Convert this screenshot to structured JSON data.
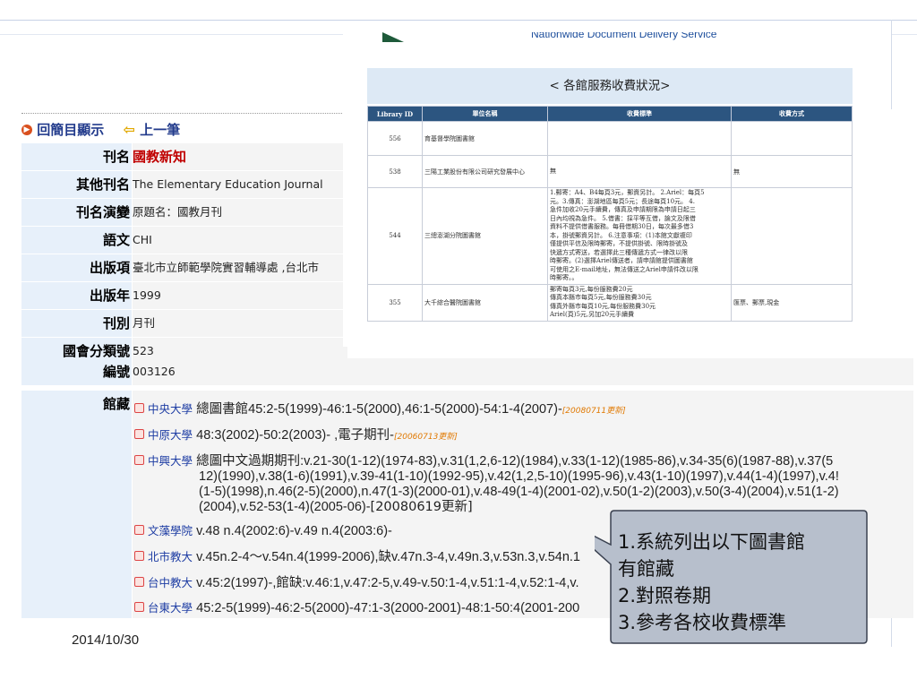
{
  "banner": {
    "text": "Nationwide Document Delivery Service"
  },
  "fee_table": {
    "heading": "< 各館服務收費狀況>",
    "columns": [
      "Library ID",
      "單位名稱",
      "收費標準",
      "收費方式"
    ],
    "rows": [
      {
        "id": "556",
        "name": "育基督學院圖書館",
        "fee": [],
        "method": ""
      },
      {
        "id": "538",
        "name": "三陽工業股份有限公司研究發展中心",
        "fee": [
          "無"
        ],
        "method": "無"
      },
      {
        "id": "544",
        "name": "三總澎湖分院圖書館",
        "fee": [
          "1.郵寄：A4、B4每頁3元，郵資另計。 2.Ariel：每頁5",
          "元。3.傳真：澎湖地區每頁5元；長途每頁10元。 4.",
          "急件加收20元手續費，傳真及申請期限為申請日起三",
          "日內均視為急件。 5.借書：採平等互借，論文及限借",
          "資料不提供借書服務。每冊借期30日，每次最多借3",
          "本，掛號郵資另計。 6.注意事項：(1)本館文獻複印",
          "僅提供平信及限時郵寄，不提供掛號、限時掛號及",
          "快遞方式寄送，若選擇此三種傳遞方式一律改以限",
          "時郵寄。(2)選擇Ariel傳送者，請申請館提供圖書館",
          "可使用之E-mail地址，無法傳送之Ariel申請件改以限",
          "時郵寄。。"
        ],
        "method": ""
      },
      {
        "id": "355",
        "name": "大千綜合醫院圖書館",
        "fee": [
          "郵寄每頁3元,每份服務費20元",
          "傳真本縣市每頁5元,每份服務費30元",
          "傳真外縣市每頁10元,每份服務費30元",
          "Ariel(頁)5元,另加20元手續費"
        ],
        "method": "匯票、郵票,現金"
      }
    ]
  },
  "nav": {
    "back_label": "回簡目顯示",
    "prev_label": "上一筆"
  },
  "record": {
    "title_label": "刊名",
    "title": "國教新知",
    "other_title_label": "其他刊名",
    "other_title": "The Elementary Education Journal",
    "history_label": "刊名演變",
    "history": "原題名：國教月刊",
    "language_label": "語文",
    "language": "CHI",
    "publisher_label": "出版項",
    "publisher": "臺北市立師範學院實習輔導處 ,台北市",
    "year_label": "出版年",
    "year": "1999",
    "frequency_label": "刊別",
    "frequency": "月刊",
    "class_label": "國會分類號",
    "class": "523",
    "code_label": "編號",
    "code": "003126",
    "holdings_label": "館藏"
  },
  "holdings": [
    {
      "library": "中央大學",
      "text": "總圖書館45:2-5(1999)-46:1-5(2000),46:1-5(2000)-54:1-4(2007)-",
      "updated": "[20080711更新]"
    },
    {
      "library": "中原大學",
      "text": "48:3(2002)-50:2(2003)- ,電子期刊-",
      "updated": "[20060713更新]"
    },
    {
      "library": "中興大學",
      "text": "總圖中文過期期刊:v.21-30(1-12)(1974-83),v.31(1,2,6-12)(1984),v.33(1-12)(1985-86),v.34-35(6)(1987-88),v.37(5",
      "continued": [
        "12)(1990),v.38(1-6)(1991),v.39-41(1-10)(1992-95),v.42(1,2,5-10)(1995-96),v.43(1-10)(1997),v.44(1-4)(1997),v.4!",
        "(1-5)(1998),n.46(2-5)(2000),n.47(1-3)(2000-01),v.48-49(1-4)(2001-02),v.50(1-2)(2003),v.50(3-4)(2004),v.51(1-2)",
        "(2004),v.52-53(1-4)(2005-06)-"
      ],
      "updated": "[20080619更新]"
    },
    {
      "library": "文藻學院",
      "text": "v.48 n.4(2002:6)-v.49 n.4(2003:6)-",
      "updated": ""
    },
    {
      "library": "北市教大",
      "text": "v.45n.2-4～v.54n.4(1999-2006),缺v.47n.3-4,v.49n.3,v.53n.3,v.54n.1",
      "updated": ""
    },
    {
      "library": "台中教大",
      "text": "v.45:2(1997)-,館缺:v.46:1,v.47:2-5,v.49-v.50:1-4,v.51:1-4,v.52:1-4,v.",
      "updated": ""
    },
    {
      "library": "台東大學",
      "text": "45:2-5(1999)-46:2-5(2000)-47:1-3(2000-2001)-48:1-50:4(2001-200",
      "updated": ""
    }
  ],
  "callout": {
    "line1": "1.系統列出以下圖書館",
    "line2": "有館藏",
    "line3": "2.對照卷期",
    "line4": "3.參考各校收費標準"
  },
  "footer": {
    "date": "2014/10/30"
  },
  "colors": {
    "label_bg": "#e7f0fa",
    "value_bg": "#f4f4f4",
    "title_red": "#c00000",
    "link_blue": "#1d3ca3",
    "update_orange": "#e07800",
    "callout_fill": "#b7bfcc",
    "table_header": "#2c5580"
  }
}
